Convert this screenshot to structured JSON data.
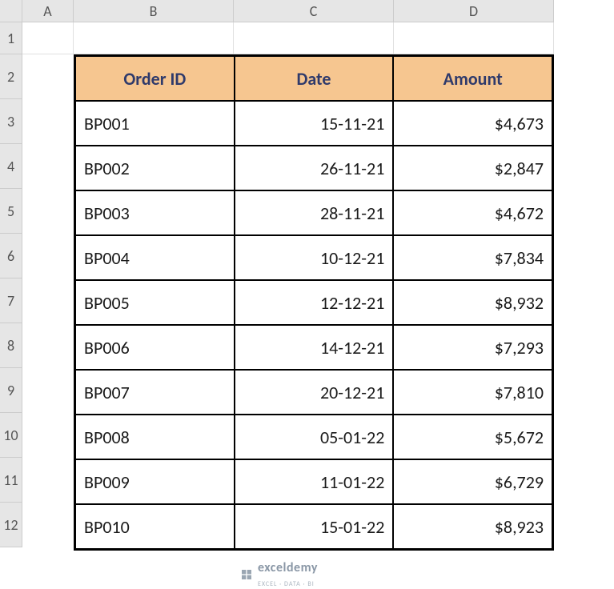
{
  "columns": [
    "A",
    "B",
    "C",
    "D"
  ],
  "rowNumbers": [
    "1",
    "2",
    "3",
    "4",
    "5",
    "6",
    "7",
    "8",
    "9",
    "10",
    "11",
    "12"
  ],
  "headers": {
    "orderId": "Order ID",
    "date": "Date",
    "amount": "Amount"
  },
  "rows": [
    {
      "orderId": "BP001",
      "date": "15-11-21",
      "amount": "$4,673"
    },
    {
      "orderId": "BP002",
      "date": "26-11-21",
      "amount": "$2,847"
    },
    {
      "orderId": "BP003",
      "date": "28-11-21",
      "amount": "$4,672"
    },
    {
      "orderId": "BP004",
      "date": "10-12-21",
      "amount": "$7,834"
    },
    {
      "orderId": "BP005",
      "date": "12-12-21",
      "amount": "$8,932"
    },
    {
      "orderId": "BP006",
      "date": "14-12-21",
      "amount": "$7,293"
    },
    {
      "orderId": "BP007",
      "date": "20-12-21",
      "amount": "$7,810"
    },
    {
      "orderId": "BP008",
      "date": "05-01-22",
      "amount": "$5,672"
    },
    {
      "orderId": "BP009",
      "date": "11-01-22",
      "amount": "$6,729"
    },
    {
      "orderId": "BP010",
      "date": "15-01-22",
      "amount": "$8,923"
    }
  ],
  "watermark": {
    "main": "exceldemy",
    "sub": "EXCEL · DATA · BI"
  },
  "chart_data": {
    "type": "table",
    "title": "",
    "columns": [
      "Order ID",
      "Date",
      "Amount"
    ],
    "data": [
      [
        "BP001",
        "15-11-21",
        4673
      ],
      [
        "BP002",
        "26-11-21",
        2847
      ],
      [
        "BP003",
        "28-11-21",
        4672
      ],
      [
        "BP004",
        "10-12-21",
        7834
      ],
      [
        "BP005",
        "12-12-21",
        8932
      ],
      [
        "BP006",
        "14-12-21",
        7293
      ],
      [
        "BP007",
        "20-12-21",
        7810
      ],
      [
        "BP008",
        "05-01-22",
        5672
      ],
      [
        "BP009",
        "11-01-22",
        6729
      ],
      [
        "BP010",
        "15-01-22",
        8923
      ]
    ]
  }
}
